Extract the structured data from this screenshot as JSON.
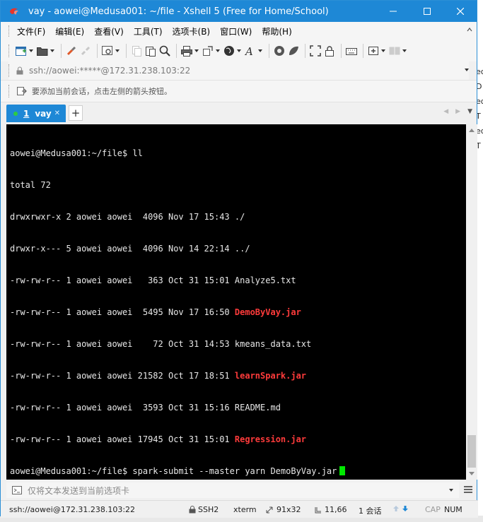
{
  "window": {
    "title": "vay - aowei@Medusa001: ~/file - Xshell 5 (Free for Home/School)",
    "accent": "#1e88d6"
  },
  "menu": [
    "文件(F)",
    "编辑(E)",
    "查看(V)",
    "工具(T)",
    "选项卡(B)",
    "窗口(W)",
    "帮助(H)"
  ],
  "address": {
    "value": "ssh://aowei:*****@172.31.238.103:22"
  },
  "hint": "要添加当前会话，点击左侧的箭头按钮。",
  "tab": {
    "number": "1",
    "label": "vay",
    "close": "✕",
    "add": "+"
  },
  "terminal": {
    "lines": [
      "aowei@Medusa001:~/file$ ll",
      "total 72",
      "drwxrwxr-x 2 aowei aowei  4096 Nov 17 15:43 ./",
      "drwxr-x--- 5 aowei aowei  4096 Nov 14 22:14 ../"
    ],
    "files": [
      {
        "perm": "-rw-rw-r-- 1 aowei aowei   363 Oct 31 15:01 ",
        "name": "Analyze5.txt",
        "jar": false
      },
      {
        "perm": "-rw-rw-r-- 1 aowei aowei  5495 Nov 17 16:50 ",
        "name": "DemoByVay.jar",
        "jar": true
      },
      {
        "perm": "-rw-rw-r-- 1 aowei aowei    72 Oct 31 14:53 ",
        "name": "kmeans_data.txt",
        "jar": false
      },
      {
        "perm": "-rw-rw-r-- 1 aowei aowei 21582 Oct 17 18:51 ",
        "name": "learnSpark.jar",
        "jar": true
      },
      {
        "perm": "-rw-rw-r-- 1 aowei aowei  3593 Oct 31 15:16 ",
        "name": "README.md",
        "jar": false
      },
      {
        "perm": "-rw-rw-r-- 1 aowei aowei 17945 Oct 31 15:01 ",
        "name": "Regression.jar",
        "jar": true
      }
    ],
    "prompt_line": "aowei@Medusa001:~/file$ spark-submit --master yarn DemoByVay.jar",
    "jar_color": "#ff3b3b",
    "cursor_color": "#00e800"
  },
  "compose": {
    "placeholder": "仅将文本发送到当前选项卡"
  },
  "status": {
    "address": "ssh://aowei@172.31.238.103:22",
    "protocol": "SSH2",
    "term": "xterm",
    "size": "91x32",
    "position": "11,66",
    "sessions": "1 会话",
    "caps": "CAP",
    "num": "NUM"
  },
  "background_fragments": [
    "ed",
    "D",
    "ed",
    "T",
    "ed",
    "T"
  ]
}
